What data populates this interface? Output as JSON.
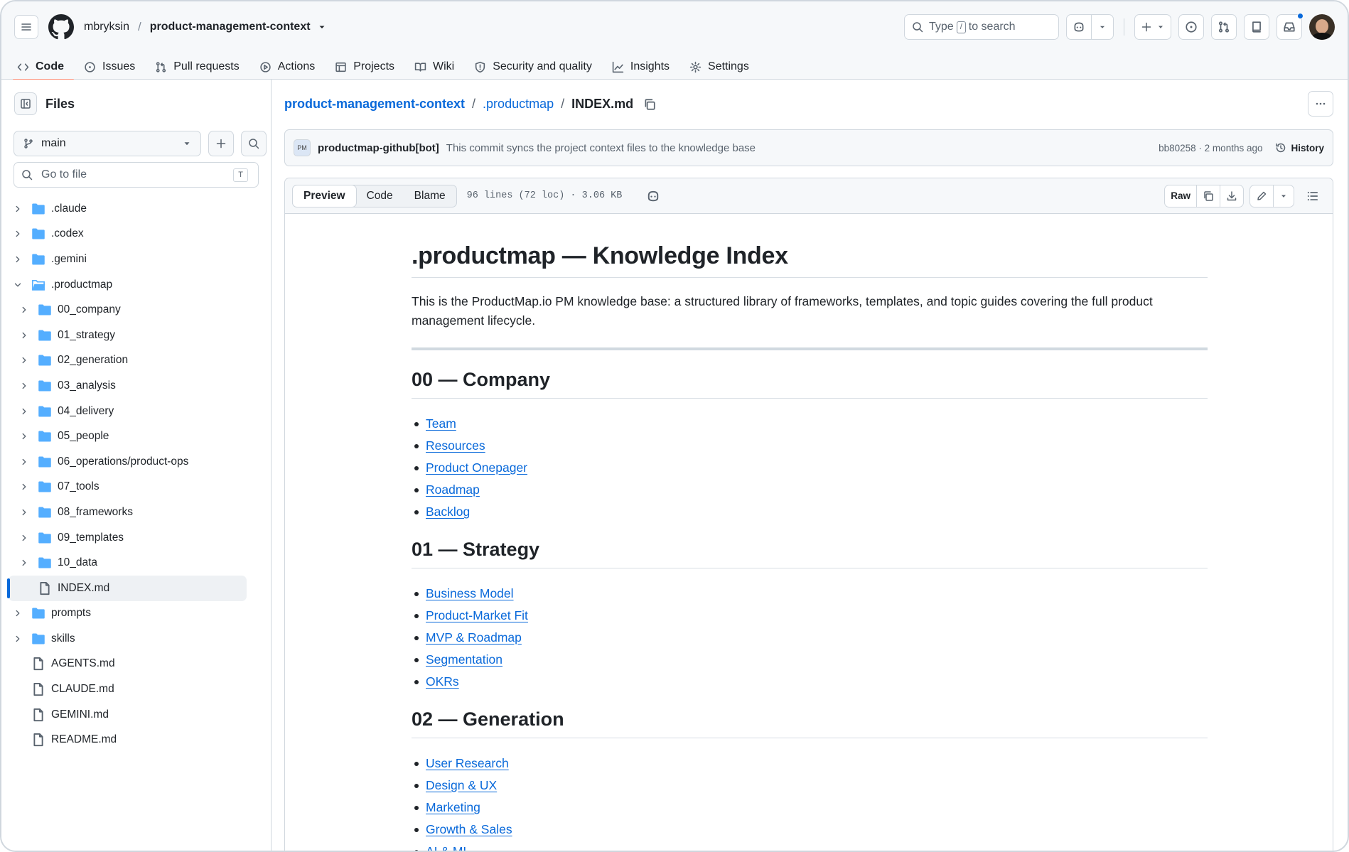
{
  "header": {
    "owner": "mbryksin",
    "repo": "product-management-context",
    "search_placeholder_prefix": "Type",
    "search_key": "/",
    "search_placeholder_suffix": "to search",
    "tabs": [
      {
        "label": "Code",
        "icon": "code-icon",
        "active": true
      },
      {
        "label": "Issues",
        "icon": "issue-icon"
      },
      {
        "label": "Pull requests",
        "icon": "pull-request-icon"
      },
      {
        "label": "Actions",
        "icon": "play-icon"
      },
      {
        "label": "Projects",
        "icon": "table-icon"
      },
      {
        "label": "Wiki",
        "icon": "book-icon"
      },
      {
        "label": "Security and quality",
        "icon": "shield-icon"
      },
      {
        "label": "Insights",
        "icon": "graph-icon"
      },
      {
        "label": "Settings",
        "icon": "gear-icon"
      }
    ],
    "notification_dot_color": "#0969da"
  },
  "sidebar": {
    "title": "Files",
    "branch": "main",
    "goto_placeholder": "Go to file",
    "goto_key": "T",
    "tree": [
      {
        "name": ".claude",
        "type": "folder",
        "depth": 0
      },
      {
        "name": ".codex",
        "type": "folder",
        "depth": 0
      },
      {
        "name": ".gemini",
        "type": "folder",
        "depth": 0
      },
      {
        "name": ".productmap",
        "type": "folder",
        "depth": 0,
        "open": true
      },
      {
        "name": "00_company",
        "type": "folder",
        "depth": 1
      },
      {
        "name": "01_strategy",
        "type": "folder",
        "depth": 1
      },
      {
        "name": "02_generation",
        "type": "folder",
        "depth": 1
      },
      {
        "name": "03_analysis",
        "type": "folder",
        "depth": 1
      },
      {
        "name": "04_delivery",
        "type": "folder",
        "depth": 1
      },
      {
        "name": "05_people",
        "type": "folder",
        "depth": 1
      },
      {
        "name": "06_operations/product-ops",
        "type": "folder",
        "depth": 1
      },
      {
        "name": "07_tools",
        "type": "folder",
        "depth": 1
      },
      {
        "name": "08_frameworks",
        "type": "folder",
        "depth": 1
      },
      {
        "name": "09_templates",
        "type": "folder",
        "depth": 1
      },
      {
        "name": "10_data",
        "type": "folder",
        "depth": 1
      },
      {
        "name": "INDEX.md",
        "type": "file",
        "depth": 1,
        "selected": true
      },
      {
        "name": "prompts",
        "type": "folder",
        "depth": 0
      },
      {
        "name": "skills",
        "type": "folder",
        "depth": 0
      },
      {
        "name": "AGENTS.md",
        "type": "file",
        "depth": 0
      },
      {
        "name": "CLAUDE.md",
        "type": "file",
        "depth": 0
      },
      {
        "name": "GEMINI.md",
        "type": "file",
        "depth": 0
      },
      {
        "name": "README.md",
        "type": "file",
        "depth": 0
      }
    ]
  },
  "breadcrumb": {
    "repo": "product-management-context",
    "folder": ".productmap",
    "file": "INDEX.md"
  },
  "commit": {
    "avatar_text": "PM",
    "author": "productmap-github[bot]",
    "message": "This commit syncs the project context files to the knowledge base",
    "sha_time": "bb80258 · 2 months ago",
    "history_label": "History"
  },
  "viewer": {
    "modes": [
      "Preview",
      "Code",
      "Blame"
    ],
    "active_mode": "Preview",
    "meta": "96 lines (72 loc) · 3.06 KB",
    "raw_label": "Raw"
  },
  "doc": {
    "title": ".productmap — Knowledge Index",
    "intro": "This is the ProductMap.io PM knowledge base: a structured library of frameworks, templates, and topic guides covering the full product management lifecycle.",
    "sections": [
      {
        "heading": "00 — Company",
        "links": [
          "Team",
          "Resources",
          "Product Onepager",
          "Roadmap",
          "Backlog"
        ]
      },
      {
        "heading": "01 — Strategy",
        "links": [
          "Business Model",
          "Product-Market Fit",
          "MVP & Roadmap",
          "Segmentation",
          "OKRs"
        ]
      },
      {
        "heading": "02 — Generation",
        "links": [
          "User Research",
          "Design & UX",
          "Marketing",
          "Growth & Sales",
          "AI & ML"
        ]
      }
    ]
  },
  "colors": {
    "link": "#0969da",
    "folder": "#54aeff",
    "tab_underline": "#fd8c73"
  }
}
